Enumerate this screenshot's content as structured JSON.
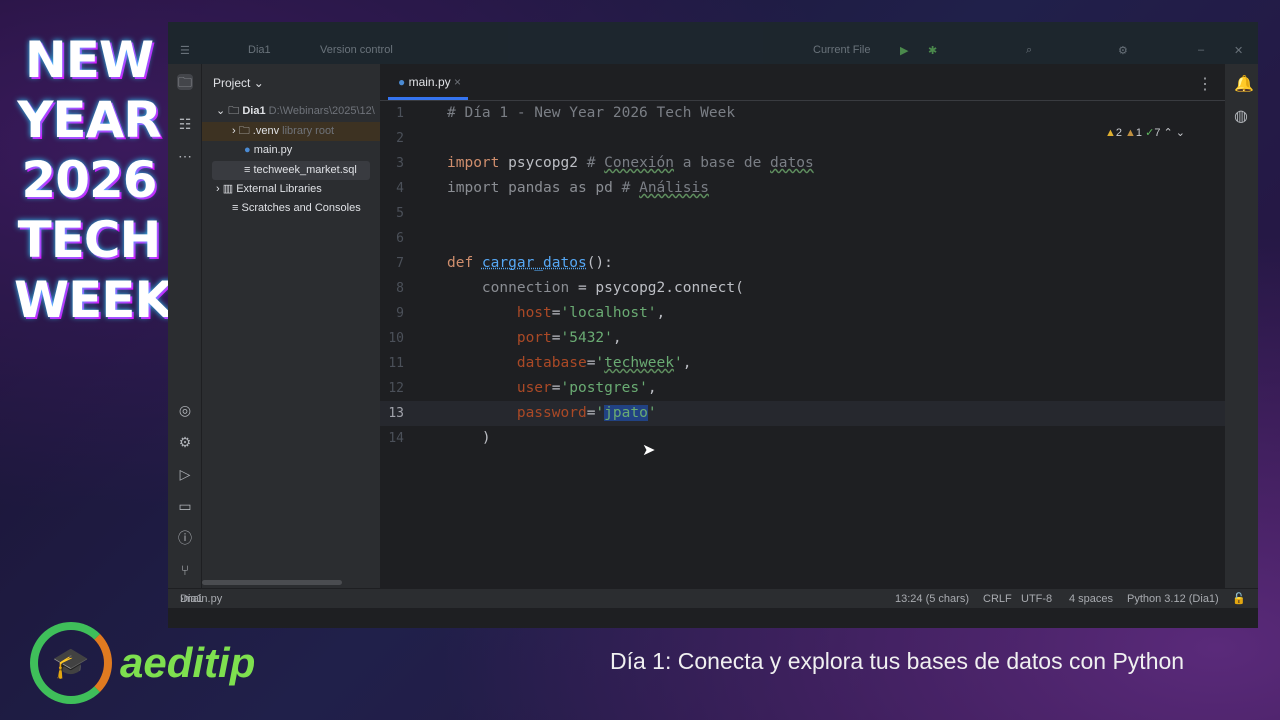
{
  "overlay": {
    "banner_lines": [
      "NEW",
      "YEAR",
      "2026",
      "TECH",
      "WEEK"
    ],
    "logo_text": "aeditip",
    "caption": "Día 1: Conecta y explora tus bases de datos con Python"
  },
  "titlebar": {
    "project": "Dia1",
    "vcs": "Version control",
    "run_config": "Current File"
  },
  "project_panel": {
    "title": "Project",
    "items": [
      {
        "label": "Dia1",
        "hint": "D:\\Webinars\\2025\\12\\",
        "icon": "folder-icon"
      },
      {
        "label": ".venv",
        "hint": "library root",
        "icon": "folder-icon"
      },
      {
        "label": "main.py",
        "hint": "",
        "icon": "python-icon"
      },
      {
        "label": "techweek_market.sql",
        "hint": "",
        "icon": "sql-file-icon"
      },
      {
        "label": "External Libraries",
        "hint": "",
        "icon": "library-icon"
      },
      {
        "label": "Scratches and Consoles",
        "hint": "",
        "icon": "scratch-icon"
      }
    ]
  },
  "editor": {
    "tab": "main.py",
    "inspections": {
      "warnings": "2",
      "weak_warnings": "1",
      "typos": "7"
    },
    "lines": [
      [
        [
          "com",
          "# Día 1 - New Year 2026 Tech Week"
        ]
      ],
      [],
      [
        [
          "kw",
          "import "
        ],
        [
          "",
          "psycopg2 "
        ],
        [
          "com",
          "# "
        ],
        [
          "comu",
          "Conexión"
        ],
        [
          "com",
          " a base de "
        ],
        [
          "comu",
          "datos"
        ]
      ],
      [
        [
          "dimkw",
          "import "
        ],
        [
          "dim",
          "pandas "
        ],
        [
          "dimkw",
          "as "
        ],
        [
          "dim",
          "pd "
        ],
        [
          "com",
          "# "
        ],
        [
          "comu",
          "Análisis"
        ]
      ],
      [],
      [],
      [
        [
          "kw",
          "def "
        ],
        [
          "fn",
          "cargar_datos"
        ],
        [
          "",
          "():"
        ]
      ],
      [
        [
          "",
          "    "
        ],
        [
          "dim",
          "connection"
        ],
        [
          "",
          " = psycopg2.connect("
        ]
      ],
      [
        [
          "",
          "        "
        ],
        [
          "par",
          "host"
        ],
        [
          "",
          "="
        ],
        [
          "str",
          "'localhost'"
        ],
        [
          "",
          ","
        ]
      ],
      [
        [
          "",
          "        "
        ],
        [
          "par",
          "port"
        ],
        [
          "",
          "="
        ],
        [
          "str",
          "'5432'"
        ],
        [
          "",
          ","
        ]
      ],
      [
        [
          "",
          "        "
        ],
        [
          "par",
          "database"
        ],
        [
          "",
          "="
        ],
        [
          "str",
          "'"
        ],
        [
          "stru",
          "techweek"
        ],
        [
          "str",
          "'"
        ],
        [
          "",
          ","
        ]
      ],
      [
        [
          "",
          "        "
        ],
        [
          "par",
          "user"
        ],
        [
          "",
          "="
        ],
        [
          "str",
          "'postgres'"
        ],
        [
          "",
          ","
        ]
      ],
      [
        [
          "",
          "        "
        ],
        [
          "par",
          "password"
        ],
        [
          "",
          "="
        ],
        [
          "str",
          "'"
        ],
        [
          "sel",
          "jpato"
        ],
        [
          "str",
          "'"
        ]
      ],
      [
        [
          "",
          "    )"
        ]
      ]
    ],
    "current_line": 13
  },
  "statusbar": {
    "breadcrumb": [
      "Dia1",
      "main.py"
    ],
    "position": "13:24 (5 chars)",
    "line_sep": "CRLF",
    "encoding": "UTF-8",
    "indent": "4 spaces",
    "interpreter": "Python 3.12 (Dia1)"
  }
}
